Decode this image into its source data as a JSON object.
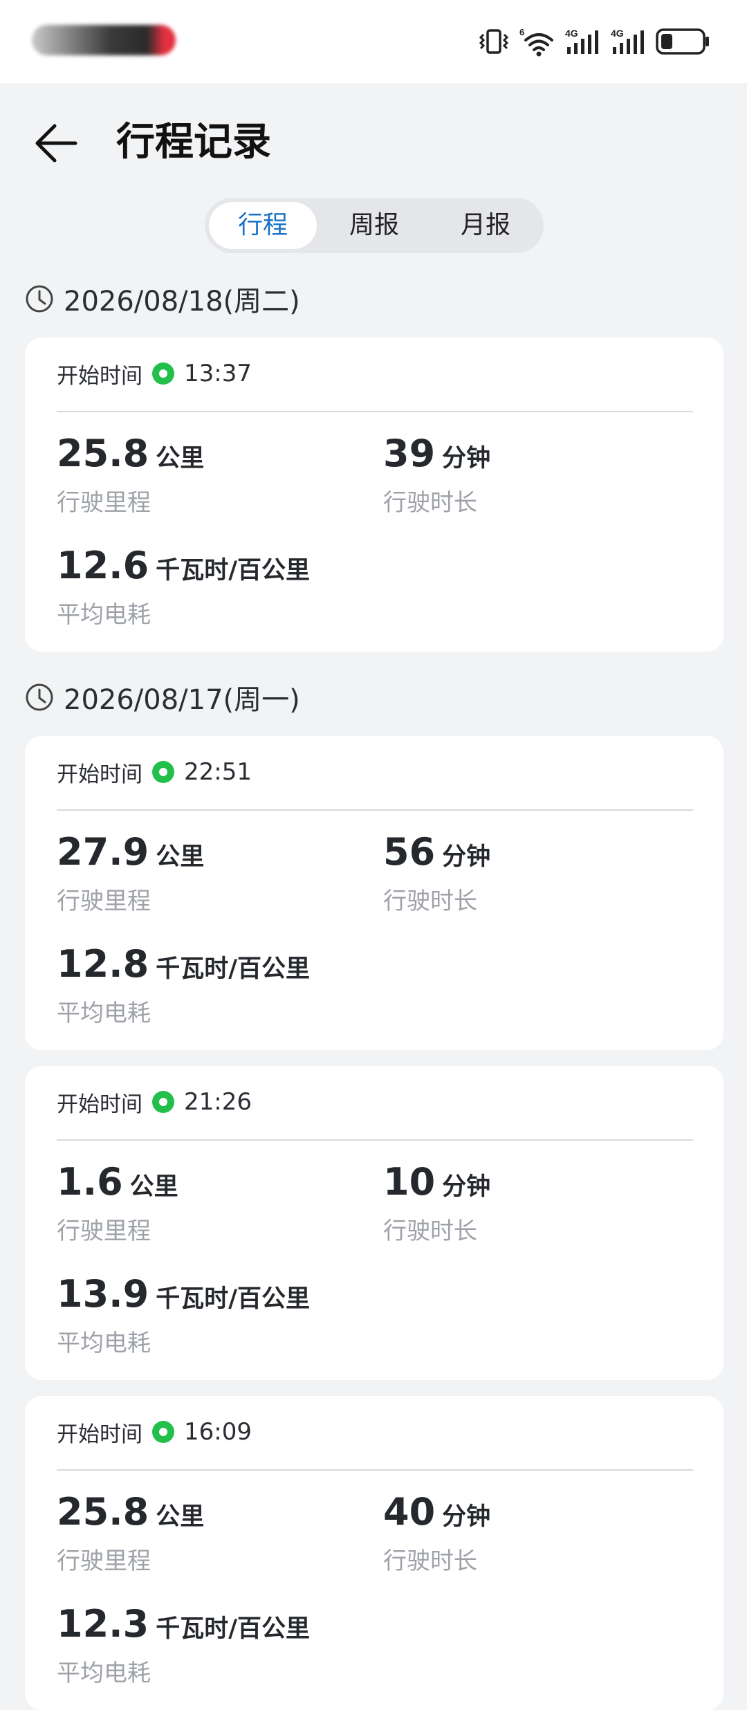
{
  "status_bar": {
    "icons": [
      "vibrate-icon",
      "wifi-icon",
      "signal-4g-icon",
      "signal-4g-icon",
      "battery-icon"
    ],
    "wifi_badge": "6",
    "sig1_badge": "4G",
    "sig2_badge": "4G"
  },
  "header": {
    "back_icon": "arrow-left-icon",
    "title": "行程记录"
  },
  "tabs": [
    {
      "label": "行程",
      "active": true
    },
    {
      "label": "周报",
      "active": false
    },
    {
      "label": "月报",
      "active": false
    }
  ],
  "colors": {
    "accent": "#1a73c8",
    "status_dot": "#22c04a",
    "background": "#f1f3f5",
    "card": "#ffffff",
    "muted_text": "#9ea2a8"
  },
  "days": [
    {
      "date": "2026/08/18(周二)",
      "trips": [
        {
          "start_label": "开始时间",
          "start_time": "13:37",
          "distance": "25.8",
          "distance_unit": "公里",
          "distance_label": "行驶里程",
          "duration": "39",
          "duration_unit": "分钟",
          "duration_label": "行驶时长",
          "efficiency": "12.6",
          "efficiency_unit": "千瓦时/百公里",
          "efficiency_label": "平均电耗"
        }
      ]
    },
    {
      "date": "2026/08/17(周一)",
      "trips": [
        {
          "start_label": "开始时间",
          "start_time": "22:51",
          "distance": "27.9",
          "distance_unit": "公里",
          "distance_label": "行驶里程",
          "duration": "56",
          "duration_unit": "分钟",
          "duration_label": "行驶时长",
          "efficiency": "12.8",
          "efficiency_unit": "千瓦时/百公里",
          "efficiency_label": "平均电耗"
        },
        {
          "start_label": "开始时间",
          "start_time": "21:26",
          "distance": "1.6",
          "distance_unit": "公里",
          "distance_label": "行驶里程",
          "duration": "10",
          "duration_unit": "分钟",
          "duration_label": "行驶时长",
          "efficiency": "13.9",
          "efficiency_unit": "千瓦时/百公里",
          "efficiency_label": "平均电耗"
        },
        {
          "start_label": "开始时间",
          "start_time": "16:09",
          "distance": "25.8",
          "distance_unit": "公里",
          "distance_label": "行驶里程",
          "duration": "40",
          "duration_unit": "分钟",
          "duration_label": "行驶时长",
          "efficiency": "12.3",
          "efficiency_unit": "千瓦时/百公里",
          "efficiency_label": "平均电耗"
        }
      ]
    }
  ]
}
